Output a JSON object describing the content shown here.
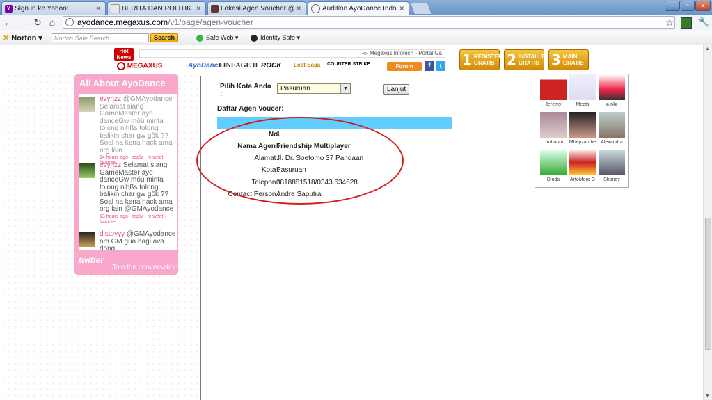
{
  "browser": {
    "tabs": [
      {
        "label": "Sign in ke Yahoo!",
        "icon": "yahoo-icon"
      },
      {
        "label": "BERITA DAN POLITIK - Kask",
        "icon": "kaskus-icon"
      },
      {
        "label": "Lokasi Agen Voucher @CAS",
        "icon": "photobucket-icon"
      },
      {
        "label": "Audition AyoDance Indone",
        "icon": "globe-icon"
      }
    ],
    "url_host": "ayodance.megaxus.com",
    "url_path": "/v1/page/agen-voucher",
    "window_buttons": {
      "minimize": "–",
      "maximize": "▫",
      "close": "x"
    }
  },
  "norton": {
    "logo": "Norton",
    "search_placeholder": "Norton Safe Search",
    "search_button": "Search",
    "safe_web": "Safe Web",
    "identity_safe": "Identity Safe"
  },
  "site_header": {
    "hot_news": "Hot News",
    "ticker": "«» Megaxus Infotech - Portal Ga",
    "logos": [
      "MEGAXUS",
      "AyoDance",
      "LINEAGE II",
      "ROCK",
      "Lost Saga",
      "COUNTER STRIKE"
    ],
    "forum_label": "Forum",
    "promos": [
      {
        "num": "1",
        "line1": "REGISTER",
        "line2": "GRATIS"
      },
      {
        "num": "2",
        "line1": "INSTALLER",
        "line2": "GRATIS"
      },
      {
        "num": "3",
        "line1": "MAIN",
        "line2": "GRATIS"
      }
    ]
  },
  "twitter_widget": {
    "title": "All About AyoDance",
    "tweets": [
      {
        "user": "evynzz",
        "text": " @GMAyodance Selamat siang GameMaster ayo danceGw mőü minta tolong nihßs tolong balikin char gw gôk ??Soal na kena hack ama org lain",
        "meta": "14 hours ago · reply · retweet · favorite"
      },
      {
        "user": "evynzz",
        "text": " Selamat siang GameMaster ayo danceGw mőü minta tolong nihßs tolong balikin char gw gôk ??Soal na kena hack ama org lain @GMAyodance",
        "meta": "13 hours ago · reply · retweet · favorite"
      },
      {
        "user": "distoyyy",
        "text": " @GMAyodance om GM gua bagi ava dong",
        "meta": ""
      }
    ],
    "footer": "twitter",
    "join": "Join the conversation"
  },
  "form": {
    "city_label": "Pilih Kota Anda :",
    "city_value": "Pasuruan",
    "submit_label": "Lanjut",
    "list_title": "Daftar Agen Voucer:"
  },
  "agent": {
    "rows": [
      {
        "key": "No.",
        "value": "1",
        "bold": true
      },
      {
        "key": "Nama Agen :",
        "value": "Friendship Multiplayer",
        "bold": true
      },
      {
        "key": "Alamat :",
        "value": "Jl. Dr. Soetomo 37 Pandaan",
        "bold": false
      },
      {
        "key": "Kota :",
        "value": "Pasuruan",
        "bold": false
      },
      {
        "key": "Telepon :",
        "value": "0818881518/0343.634628",
        "bold": false
      },
      {
        "key": "Contact Person :",
        "value": "Andre Saputra",
        "bold": false
      }
    ]
  },
  "gallery": {
    "members": [
      "Jeremy",
      "Meats",
      "ǝɹnʇɐ",
      "Umbaran",
      "Mbepzambe",
      "Alexandra",
      "Dinda",
      "ArtoMoro G",
      "Shandy"
    ]
  }
}
